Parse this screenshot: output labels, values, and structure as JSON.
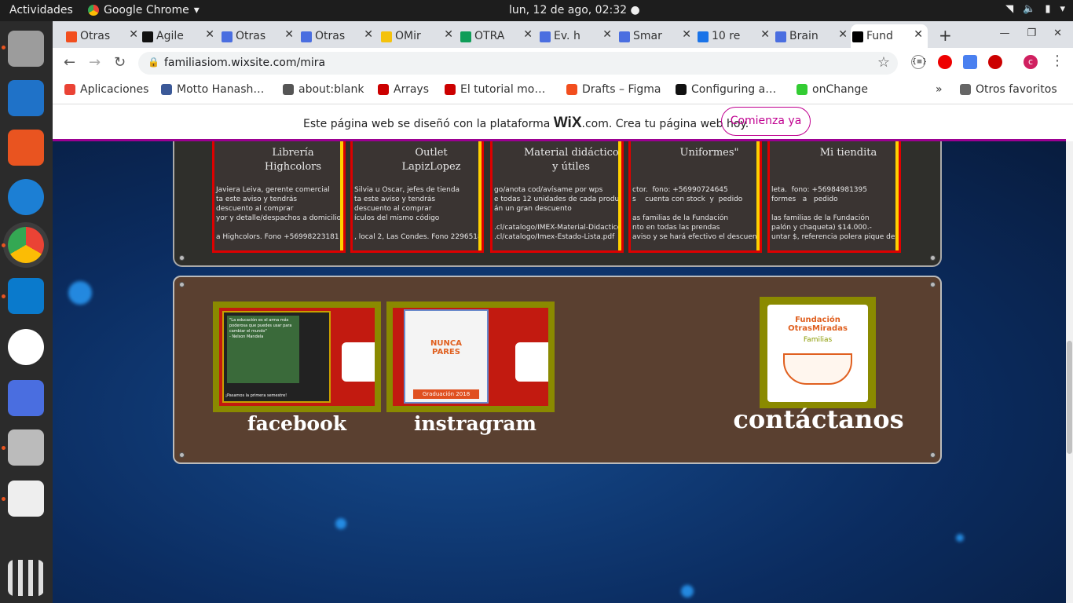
{
  "topbar": {
    "activities": "Actividades",
    "app": "Google Chrome",
    "clock": "lun, 12 de ago, 02:32"
  },
  "tabs": [
    {
      "label": "Otras",
      "color": "#f24e1e"
    },
    {
      "label": "Agile",
      "color": "#111"
    },
    {
      "label": "Otras",
      "color": "#4a6ee0"
    },
    {
      "label": "Otras",
      "color": "#4a6ee0"
    },
    {
      "label": "OMir",
      "color": "#f4c20d"
    },
    {
      "label": "OTRA",
      "color": "#0f9d58"
    },
    {
      "label": "Ev. h",
      "color": "#4a6ee0"
    },
    {
      "label": "Smar",
      "color": "#4a6ee0"
    },
    {
      "label": "10 re",
      "color": "#1a73e8"
    },
    {
      "label": "Brain",
      "color": "#4a6ee0"
    },
    {
      "label": "Fund",
      "color": "#000"
    }
  ],
  "url": "familiasiom.wixsite.com/mira",
  "bookmarks": [
    {
      "label": "Aplicaciones",
      "color": "#ea4335"
    },
    {
      "label": "Motto Hanash…",
      "color": "#3b5998"
    },
    {
      "label": "about:blank",
      "color": "#555"
    },
    {
      "label": "Arrays",
      "color": "#c00"
    },
    {
      "label": "El tutorial mo…",
      "color": "#c00"
    },
    {
      "label": "Drafts – Figma",
      "color": "#f24e1e"
    },
    {
      "label": "Configuring a…",
      "color": "#111"
    },
    {
      "label": "onChange",
      "color": "#3c3"
    },
    {
      "label": "»",
      "color": ""
    },
    {
      "label": "Otros favoritos",
      "color": "#666"
    }
  ],
  "wix": {
    "message": "Este página web se diseñó con la plataforma",
    "brand": "WiX",
    "suffix": ".com. Crea tu página web hoy.",
    "cta": "Comienza ya"
  },
  "cards": [
    {
      "title": "Librería\nHighcolors",
      "text": "Javiera Leiva, gerente comercial\nta este aviso y tendrás\ndescuento al comprar\nyor y detalle/despachos a domicilio\n\na Highcolors. Fono +56998223181"
    },
    {
      "title": "Outlet\nLapizLopez",
      "text": "Silvia u Oscar, jefes de tienda\nta este aviso y tendrás\ndescuento al comprar\nículos del mismo código\n\n, local 2, Las Condes. Fono 229651898"
    },
    {
      "title": "Material didáctico\ny útiles",
      "text": "go/anota cod/avísame por wps\ne todas 12 unidades de cada producto\nán un gran descuento\n\n.cl/catalogo/IMEX-Material-Didactico.pdf\n.cl/catalogo/Imex-Estado-Lista.pdf"
    },
    {
      "title": "Uniformes\"",
      "text": "ctor.  fono: +56990724645\ns    cuenta con stock  y  pedido\n\nas familias de la Fundación\nnto en todas las prendas\naviso y se hará efectivo el descuento."
    },
    {
      "title": "Mi tiendita",
      "text": "leta.  fono: +56984981395\nformes   a   pedido\n\nlas familias de la Fundación\npalón y chaqueta) $14.000.-\nuntar $, referencia polera pique desde $6500.-"
    }
  ],
  "social": {
    "facebook": "facebook",
    "instagram": "instragram",
    "contact": "contáctanos"
  },
  "fb_thumb": {
    "quote": "\"La educación es el arma más poderosa que puedes usar para cambiar el mundo\"",
    "author": "- Nelson Mandela",
    "footer": "¡Pasamos la primera semestre!"
  },
  "ig_thumb": {
    "headline": "NUNCA PARES",
    "caption": "Graduación 2018"
  },
  "logo": {
    "text": "Fundación OtrasMiradas",
    "sub": "Familias"
  }
}
